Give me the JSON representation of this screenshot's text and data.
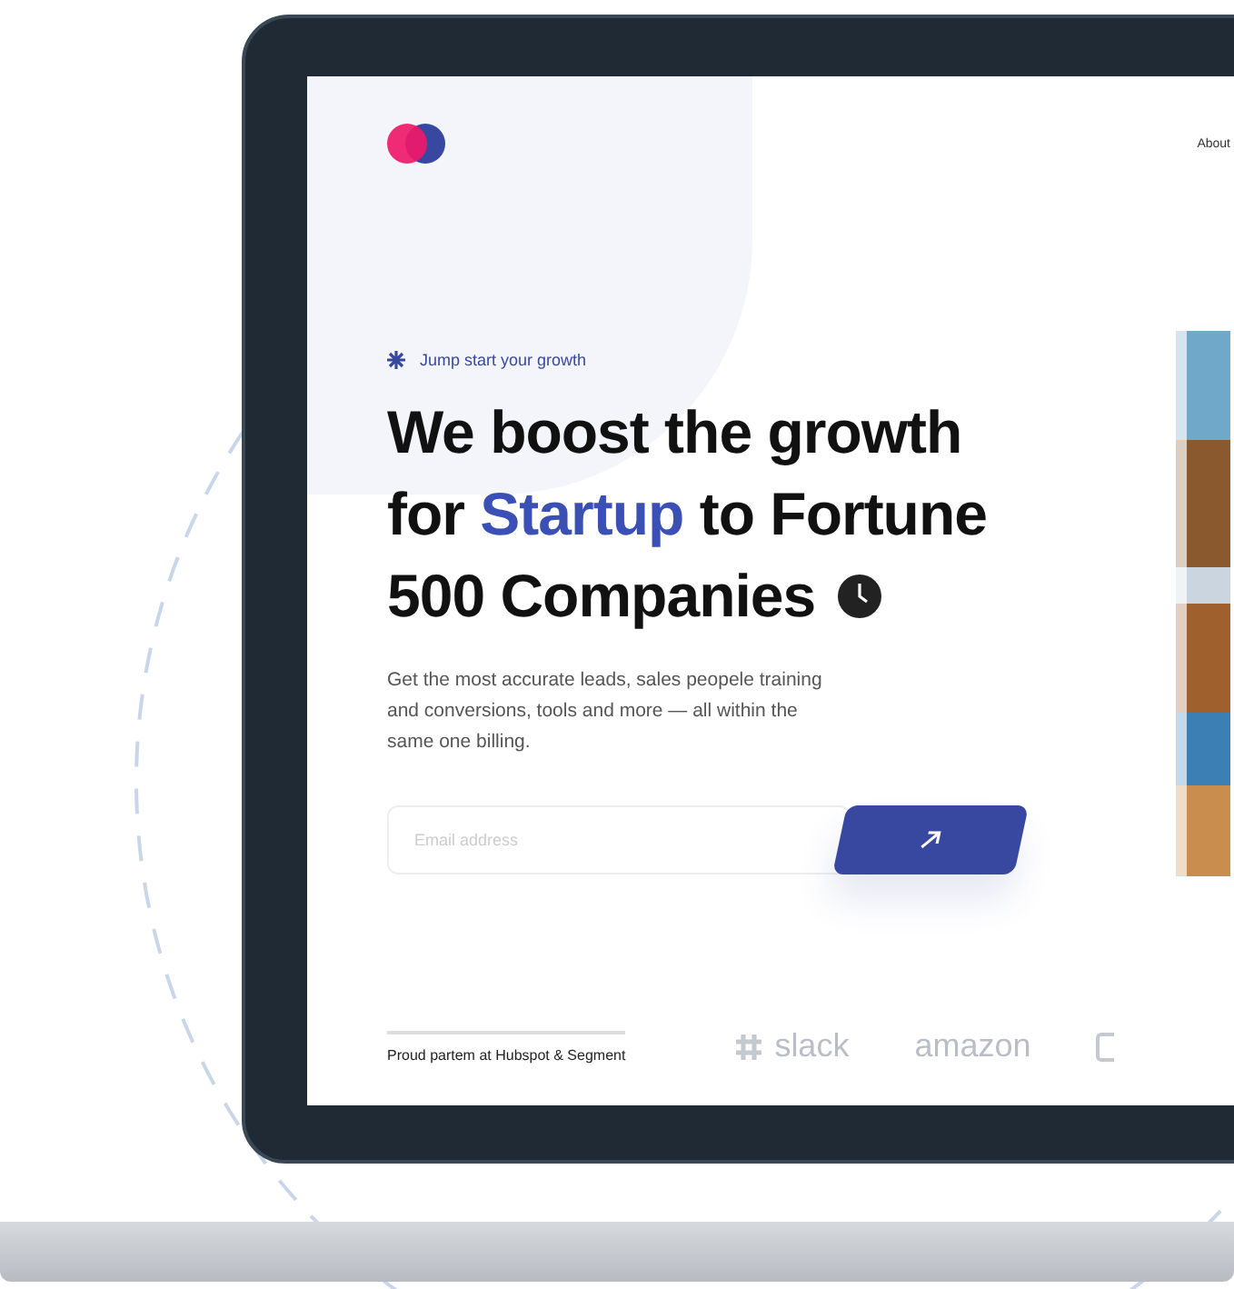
{
  "nav": {
    "link": "About"
  },
  "hero": {
    "eyebrow": "Jump start your growth",
    "line1": "We boost the growth",
    "line2_before": "for ",
    "highlight": "Startup",
    "line2_after": " to Fortune",
    "line3": "500 Companies",
    "description": "Get the most accurate leads, sales peopele training and conversions, tools and more — all within the same one billing."
  },
  "signup": {
    "placeholder": "Email address"
  },
  "partners": {
    "text": "Proud partem at Hubspot & Segment",
    "logos": [
      "slack",
      "amazon"
    ]
  }
}
